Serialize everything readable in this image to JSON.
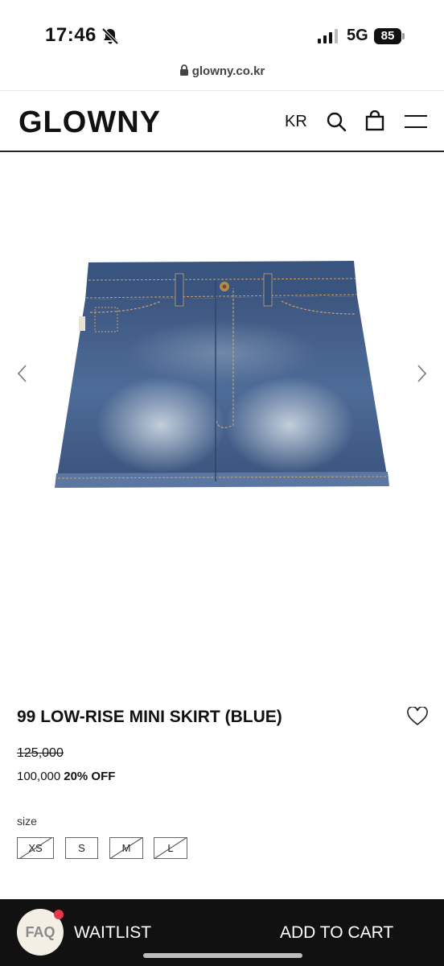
{
  "status": {
    "time": "17:46",
    "network": "5G",
    "battery": "85"
  },
  "browser": {
    "url": "glowny.co.kr"
  },
  "header": {
    "logo": "GLOWNY",
    "language": "KR"
  },
  "product": {
    "name": "99 LOW-RISE MINI SKIRT (BLUE)",
    "original_price": "125,000",
    "sale_price": "100,000",
    "discount": "20% OFF",
    "size_label": "size",
    "sizes": [
      {
        "label": "XS",
        "sold_out": true
      },
      {
        "label": "S",
        "sold_out": false
      },
      {
        "label": "M",
        "sold_out": true
      },
      {
        "label": "L",
        "sold_out": true
      }
    ]
  },
  "bottom_bar": {
    "faq": "FAQ",
    "waitlist": "WAITLIST",
    "add_to_cart": "ADD TO CART"
  },
  "colors": {
    "denim": "#3f5e8a",
    "bar": "#111111",
    "badge": "#e8394a"
  },
  "icons": [
    "bell-slash-icon",
    "signal-icon",
    "lock-icon",
    "search-icon",
    "bag-icon",
    "menu-icon",
    "chevron-left-icon",
    "chevron-right-icon",
    "heart-icon"
  ]
}
